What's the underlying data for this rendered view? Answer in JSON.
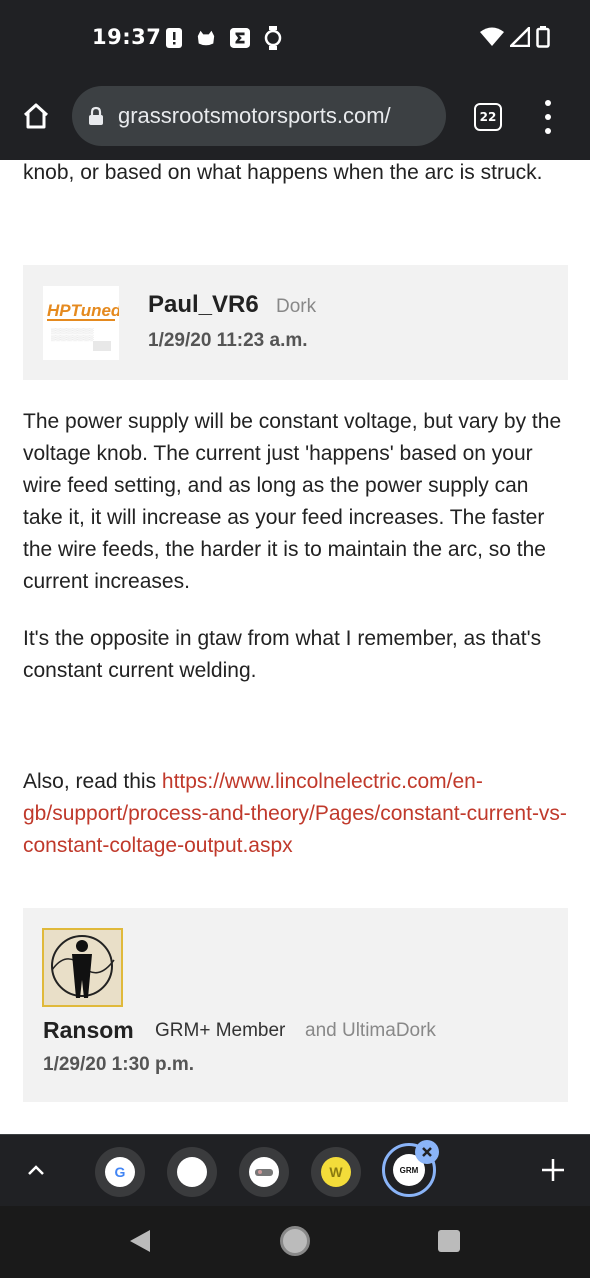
{
  "status_bar": {
    "time": "19:37"
  },
  "browser": {
    "url": "grassrootsmotorsports.com/",
    "tab_count": "22"
  },
  "content": {
    "intro_text": "knob, or based on what happens when the arc is struck.",
    "post1": {
      "author": "Paul_VR6",
      "role": "Dork",
      "date": "1/29/20 11:23 a.m.",
      "avatar_text": "HPTuned"
    },
    "reply_p1": "The power supply will be constant voltage, but vary by the voltage knob. The current just 'happens' based on your wire feed setting, and as long as the power supply can take it, it will increase as your feed increases. The faster the wire feeds, the harder it is to maintain the arc, so the current increases.",
    "reply_p2": "It's the opposite in gtaw from what I remember, as that's constant current welding.",
    "reply_p3_prefix": "Also, read this ",
    "reply_p3_link": "https://www.lincolnelectric.com/en-gb/support/process-and-theory/Pages/constant-current-vs-constant-coltage-output.aspx",
    "post2": {
      "author": "Ransom",
      "role_primary": "GRM+ Member",
      "role_secondary": "and UltimaDork",
      "date": "1/29/20 1:30 p.m."
    }
  },
  "tab_strip": {
    "tabs": [
      {
        "icon": "google-icon",
        "label": "G"
      },
      {
        "icon": "blank-page-icon",
        "label": ""
      },
      {
        "icon": "site-favicon-icon",
        "label": ""
      },
      {
        "icon": "w-favicon-icon",
        "label": "W"
      },
      {
        "icon": "grm-favicon-icon",
        "label": "GRM"
      }
    ]
  },
  "colors": {
    "link": "#c0392b",
    "card_bg": "#f2f2f2",
    "chrome_dark": "#202124",
    "accent": "#8ab4f8"
  }
}
